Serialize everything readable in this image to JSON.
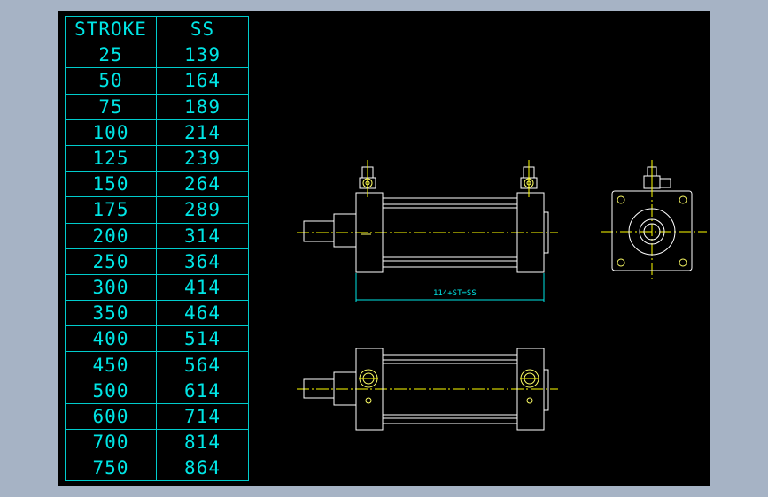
{
  "table": {
    "headers": [
      "STROKE",
      "SS"
    ],
    "rows": [
      [
        "25",
        "139"
      ],
      [
        "50",
        "164"
      ],
      [
        "75",
        "189"
      ],
      [
        "100",
        "214"
      ],
      [
        "125",
        "239"
      ],
      [
        "150",
        "264"
      ],
      [
        "175",
        "289"
      ],
      [
        "200",
        "314"
      ],
      [
        "250",
        "364"
      ],
      [
        "300",
        "414"
      ],
      [
        "350",
        "464"
      ],
      [
        "400",
        "514"
      ],
      [
        "450",
        "564"
      ],
      [
        "500",
        "614"
      ],
      [
        "600",
        "714"
      ],
      [
        "700",
        "814"
      ],
      [
        "750",
        "864"
      ]
    ]
  },
  "dimension_label": "114+ST=SS",
  "colors": {
    "outline": "#ffffff",
    "centerline": "#ffff00",
    "detail": "#ffff66",
    "dimension": "#00e5e5",
    "background": "#000000",
    "frame": "#a6b3c5"
  }
}
